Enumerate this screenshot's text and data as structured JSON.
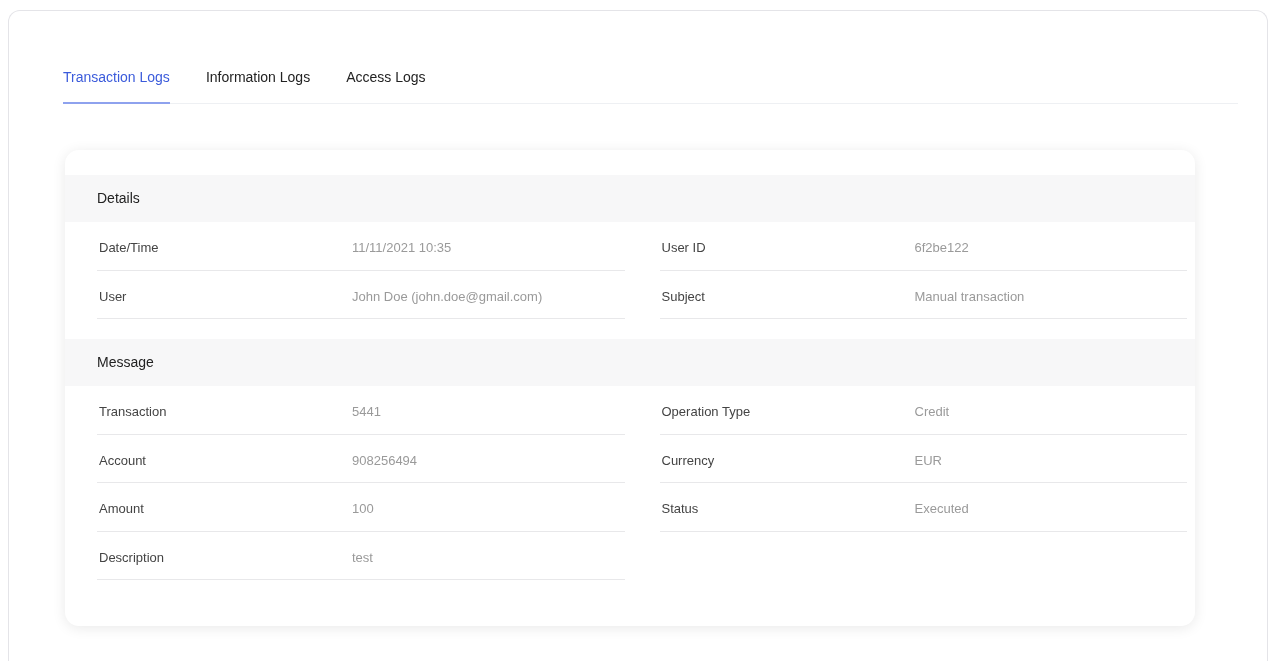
{
  "tabs": [
    {
      "label": "Transaction Logs",
      "selected": true
    },
    {
      "label": "Information Logs",
      "selected": false
    },
    {
      "label": "Access Logs",
      "selected": false
    }
  ],
  "sections": [
    {
      "title": "Details",
      "fields": [
        {
          "label": "Date/Time",
          "value": "11/11/2021 10:35"
        },
        {
          "label": "User ID",
          "value": "6f2be122"
        },
        {
          "label": "User",
          "value": "John Doe (john.doe@gmail.com)"
        },
        {
          "label": "Subject",
          "value": "Manual transaction"
        }
      ]
    },
    {
      "title": "Message",
      "fields": [
        {
          "label": "Transaction",
          "value": "5441"
        },
        {
          "label": "Operation Type",
          "value": "Credit"
        },
        {
          "label": "Account",
          "value": "908256494"
        },
        {
          "label": "Currency",
          "value": "EUR"
        },
        {
          "label": "Amount",
          "value": "100"
        },
        {
          "label": "Status",
          "value": "Executed"
        },
        {
          "label": "Description",
          "value": "test"
        }
      ]
    }
  ]
}
